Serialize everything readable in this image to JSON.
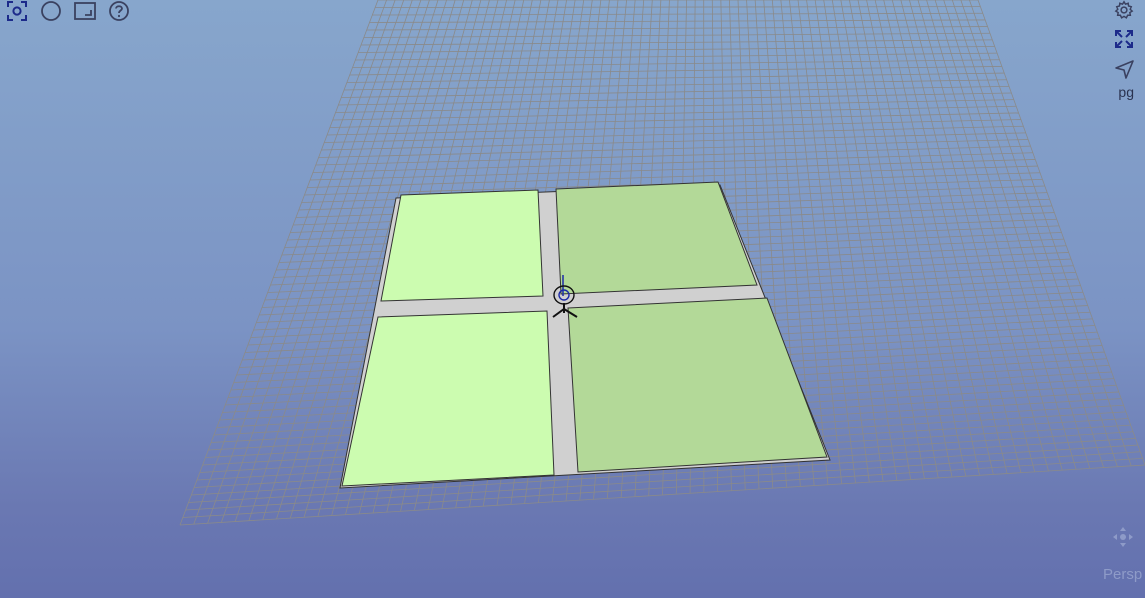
{
  "toolbar_left": [
    {
      "icon": "focus-icon"
    },
    {
      "icon": "circle-icon"
    },
    {
      "icon": "frame-icon"
    },
    {
      "icon": "help-icon"
    }
  ],
  "toolbar_right": [
    {
      "icon": "gear-icon"
    },
    {
      "icon": "fullscreen-icon"
    },
    {
      "icon": "navigate-icon"
    }
  ],
  "labels": {
    "pg": "pg",
    "projection": "Persp"
  },
  "scene": {
    "background_top": "#87a6cc",
    "background_bottom": "#6370ae",
    "grid_color": "#8a8a8a",
    "parcel_light": "#ccfcb0",
    "parcel_dark": "#b3d998",
    "road_color": "#d0d0d0",
    "parcel_outline": "#333333",
    "axis_marker_color": "#1c2aa8"
  },
  "colors": {
    "icon_primary": "#1c2a8a",
    "icon_secondary": "#3a4160"
  }
}
